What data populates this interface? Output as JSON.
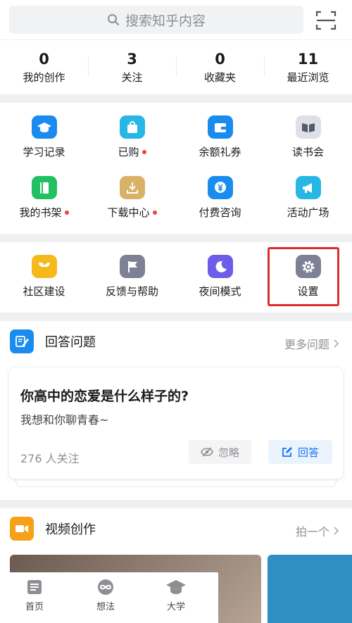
{
  "search": {
    "placeholder": "搜索知乎内容",
    "icon": "search-icon"
  },
  "scan": {
    "icon": "scan-icon"
  },
  "stats": [
    {
      "value": "0",
      "label": "我的创作"
    },
    {
      "value": "3",
      "label": "关注"
    },
    {
      "value": "0",
      "label": "收藏夹"
    },
    {
      "value": "11",
      "label": "最近浏览"
    }
  ],
  "tools": [
    {
      "label": "学习记录",
      "icon": "graduation-cap-icon",
      "color": "#1a8cf0",
      "dot": false
    },
    {
      "label": "已购",
      "icon": "shopping-bag-icon",
      "color": "#27b7e5",
      "dot": true
    },
    {
      "label": "余额礼券",
      "icon": "wallet-icon",
      "color": "#1a8cf0",
      "dot": false
    },
    {
      "label": "读书会",
      "icon": "open-book-icon",
      "color": "#8e92a8",
      "dot": false
    },
    {
      "label": "我的书架",
      "icon": "bookshelf-icon",
      "color": "#22c063",
      "dot": true
    },
    {
      "label": "下载中心",
      "icon": "download-icon",
      "color": "#d9b26a",
      "dot": true
    },
    {
      "label": "付费咨询",
      "icon": "yen-chat-icon",
      "color": "#1a8cf0",
      "dot": false
    },
    {
      "label": "活动广场",
      "icon": "megaphone-icon",
      "color": "#27b7e5",
      "dot": false
    }
  ],
  "more_tools": [
    {
      "label": "社区建设",
      "icon": "sprout-icon",
      "color": "#f6b91a"
    },
    {
      "label": "反馈与帮助",
      "icon": "flag-icon",
      "color": "#7e8196"
    },
    {
      "label": "夜间模式",
      "icon": "moon-icon",
      "color": "#6d5ce8"
    },
    {
      "label": "设置",
      "icon": "gear-icon",
      "color": "#7e8196"
    }
  ],
  "answer_section": {
    "title": "回答问题",
    "more": "更多问题",
    "question": {
      "title": "你高中的恋爱是什么样子的?",
      "subtitle": "我想和你聊青春~",
      "followers": "276 人关注",
      "ignore": "忽略",
      "answer": "回答"
    }
  },
  "video_section": {
    "title": "视频创作",
    "more": "拍一个"
  },
  "tabs": [
    {
      "label": "首页",
      "icon": "home-icon"
    },
    {
      "label": "想法",
      "icon": "idea-icon"
    },
    {
      "label": "大学",
      "icon": "university-icon"
    }
  ],
  "colors": {
    "accent": "#1772f6",
    "highlight": "#e02b2b",
    "video": "#f7a11a",
    "answer_icon": "#1a8cf0"
  }
}
